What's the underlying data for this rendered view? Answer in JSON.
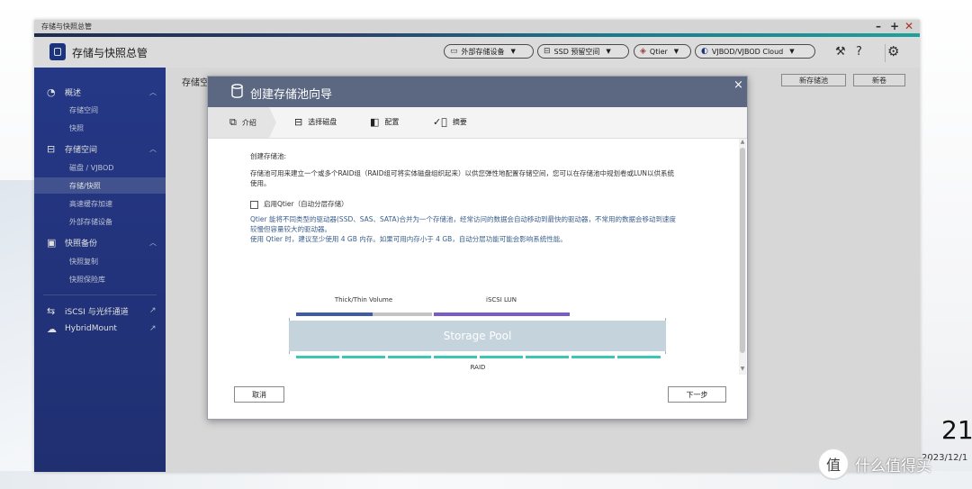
{
  "window": {
    "title": "存储与快照总管",
    "controls": [
      "–",
      "+",
      "✕"
    ]
  },
  "header": {
    "app_title": "存储与快照总管",
    "pills": [
      {
        "icon": "external-storage-icon",
        "label": "外部存储设备"
      },
      {
        "icon": "ssd-icon",
        "label": "SSD 预留空间"
      },
      {
        "icon": "qtier-icon",
        "label": "Qtier"
      },
      {
        "icon": "vjbod-icon",
        "label": "VJBOD/VJBOD Cloud"
      }
    ]
  },
  "sidebar": {
    "sections": [
      {
        "icon": "dashboard-icon",
        "label": "概述",
        "items": [
          "存储空间",
          "快照"
        ]
      },
      {
        "icon": "storage-icon",
        "label": "存储空间",
        "items": [
          "磁盘 / VJBOD",
          "存储/快照",
          "高速缓存加速",
          "外部存储设备"
        ],
        "active": "存储/快照"
      },
      {
        "icon": "backup-icon",
        "label": "快照备份",
        "items": [
          "快照复制",
          "快照保险库"
        ]
      }
    ],
    "links": [
      {
        "icon": "iscsi-icon",
        "label": "iSCSI 与光纤通道"
      },
      {
        "icon": "cloud-icon",
        "label": "HybridMount"
      }
    ]
  },
  "main": {
    "title": "存储空",
    "new_pool_button": "新存储池",
    "new_volume_button": "新卷"
  },
  "wizard": {
    "title": "创建存储池向导",
    "close": "×",
    "steps": [
      "介绍",
      "选择磁盘",
      "配置",
      "摘要"
    ],
    "heading": "创建存储池:",
    "intro_line1": "存储池可用来建立一个或多个RAID组（RAID组可将实体磁盘组织起来）以供您弹性地配置存储空间，您可以在存储池中规划卷或LUN以供系统",
    "intro_line2": "使用。",
    "qtier_checkbox": "启用Qtier（自动分层存储）",
    "qtier_desc1": "Qtier 能将不同类型的驱动器(SSD、SAS、SATA)合并为一个存储池，经常访问的数据会自动移动到最快的驱动器，不常用的数据会移动到速度",
    "qtier_desc2": "较慢但容量较大的驱动器。",
    "qtier_desc3": "使用 Qtier 时，建议至少使用 4 GB 内存。如果可用内存小于 4 GB，自动分层功能可能会影响系统性能。",
    "diagram": {
      "volume_label": "Thick/Thin Volume",
      "lun_label": "iSCSI LUN",
      "pool_label": "Storage Pool",
      "raid_label": "RAID",
      "colors": {
        "volume": "#3f5aa6",
        "volume_rest": "#c3c3c3",
        "lun": "#7a5cc7",
        "pool": "#c5d3dd",
        "raid": "#3cc7b3"
      }
    },
    "cancel_button": "取消",
    "next_button": "下一步"
  },
  "overlay_text": {
    "clock": "21",
    "date": "2023/12/1",
    "watermark": "什么值得买",
    "watermark_icon": "值"
  }
}
